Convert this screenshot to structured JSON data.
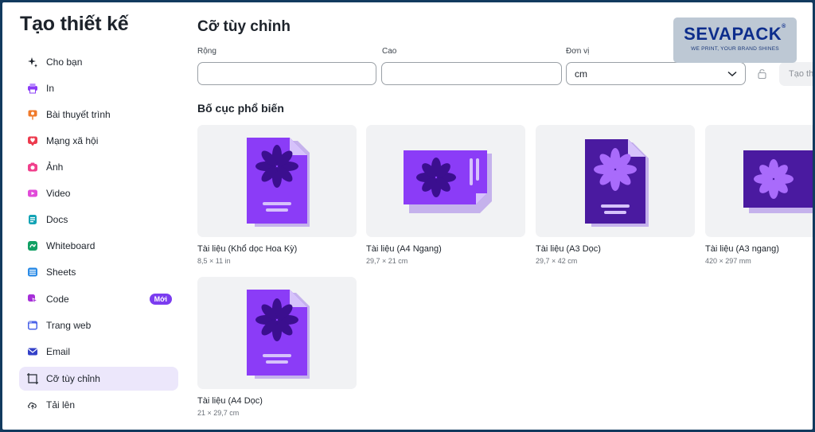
{
  "sidebar": {
    "title": "Tạo thiết kế",
    "items": [
      {
        "label": "Cho bạn",
        "icon": "sparkle-icon"
      },
      {
        "label": "In",
        "icon": "printer-icon"
      },
      {
        "label": "Bài thuyết trình",
        "icon": "presentation-icon"
      },
      {
        "label": "Mạng xã hội",
        "icon": "heart-icon"
      },
      {
        "label": "Ảnh",
        "icon": "camera-icon"
      },
      {
        "label": "Video",
        "icon": "video-icon"
      },
      {
        "label": "Docs",
        "icon": "docs-icon"
      },
      {
        "label": "Whiteboard",
        "icon": "whiteboard-icon"
      },
      {
        "label": "Sheets",
        "icon": "sheets-icon"
      },
      {
        "label": "Code",
        "icon": "code-icon",
        "badge": "Mới"
      },
      {
        "label": "Trang web",
        "icon": "website-icon"
      },
      {
        "label": "Email",
        "icon": "email-icon"
      },
      {
        "label": "Cỡ tùy chỉnh",
        "icon": "custom-size-icon",
        "active": true
      },
      {
        "label": "Tải lên",
        "icon": "cloud-upload-icon"
      }
    ]
  },
  "main": {
    "title": "Cỡ tùy chỉnh",
    "width_label": "Rộng",
    "width_value": "",
    "height_label": "Cao",
    "height_value": "",
    "unit_label": "Đơn vị",
    "unit_value": "cm",
    "create_label": "Tạo th",
    "section_title": "Bố cục phổ biến",
    "layouts": [
      {
        "title": "Tài liệu (Khổ dọc Hoa Kỳ)",
        "size": "8,5 × 11 in"
      },
      {
        "title": "Tài liệu (A4 Ngang)",
        "size": "29,7 × 21 cm"
      },
      {
        "title": "Tài liệu (A3 Dọc)",
        "size": "29,7 × 42 cm"
      },
      {
        "title": "Tài liệu (A3 ngang)",
        "size": "420 × 297 mm"
      },
      {
        "title": "Tài liệu (A4 Dọc)",
        "size": "21 × 29,7 cm"
      }
    ]
  },
  "watermark": {
    "name": "SEVAPACK",
    "registered": "®",
    "tagline": "WE PRINT, YOUR BRAND SHINES"
  },
  "colors": {
    "accent": "#7b3cf0",
    "doc_violet": "#8b3cf7",
    "doc_deep": "#4a1aa0",
    "active_bg": "#ece7fb"
  }
}
